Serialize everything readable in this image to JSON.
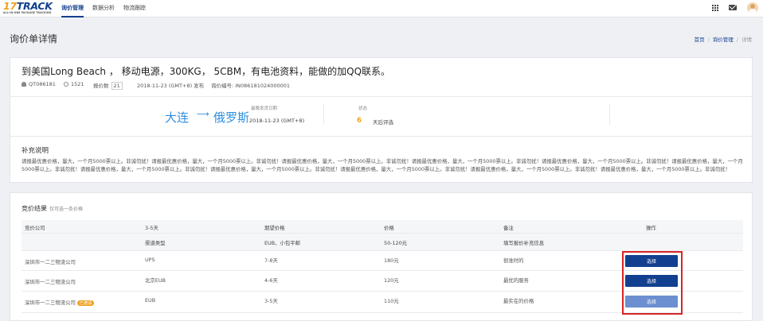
{
  "nav": {
    "logo_main_1": "17",
    "logo_main_2": "TRACK",
    "logo_sub": "ALL-IN-ONE PACKAGE TRACKING",
    "items": [
      "询价管理",
      "数据分析",
      "物流跟踪"
    ]
  },
  "page": {
    "title": "询价单详情",
    "breadcrumb": [
      "首页",
      "询价管理",
      "详情"
    ]
  },
  "inquiry": {
    "title": "到美国Long Beach ， 移动电源，300KG， 5CBM，有电池资料，能做的加QQ联系。",
    "user": "QT086181",
    "views": "1521",
    "quote_label": "报价数",
    "quote_count": "21",
    "published": "2018-11-23 (GMT+8) 发布",
    "inquiry_no": "询价编号: IN086181024000001",
    "from": "大连",
    "to": "俄罗斯",
    "arrow": "⟶",
    "ship_date_label": "最晚发货日期",
    "ship_date": "2018-11-23 (GMT+8)",
    "status_label": "状态",
    "status_days": "6",
    "status_text": "天后评选",
    "note_title": "补充说明",
    "note_text": "请报最优惠价格，量大，一个月5000票以上。非诚勿扰！请报最优惠价格，量大，一个月5000票以上。非诚勿扰！请报最优惠价格，量大，一个月5000票以上。非诚勿扰！请报最优惠价格，量大，一个月5000票以上。非诚勿扰！请报最优惠价格，量大，一个月5000票以上。非诚勿扰！请报最优惠价格，量大，一个月5000票以上。非诚勿扰！请报最优惠价格，量大，一个月5000票以上。非诚勿扰！请报最优惠价格，量大，一个月5000票以上。非诚勿扰！请报最优惠价格，量大，一个月5000票以上。非诚勿扰！请报最优惠价格，量大，一个月5000票以上。非诚勿扰！请报最优惠价格，量大，一个月5000票以上。非诚勿扰！"
  },
  "results": {
    "title": "竞价结果",
    "hint": "仅可选一条价格",
    "header": [
      "竞价公司",
      "3-5天",
      "期望价格",
      "价格",
      "备注",
      "操作"
    ],
    "subheader": [
      "",
      "渠道类型",
      "EUB、小包平邮",
      "50-120元",
      "填写报价补充信息",
      ""
    ],
    "rows": [
      {
        "company": "深圳市一二三物流公司",
        "badge": "",
        "channel": "UPS",
        "days": "7-8天",
        "price": "180元",
        "remark": "很准时的",
        "action": "选择"
      },
      {
        "company": "深圳市一二三物流公司",
        "badge": "",
        "channel": "北京EUB",
        "days": "4-6天",
        "price": "120元",
        "remark": "最优的服务",
        "action": "选择"
      },
      {
        "company": "深圳市一二三物流公司",
        "badge": "已邀请",
        "channel": "EUB",
        "days": "3-5天",
        "price": "110元",
        "remark": "最实在的价格",
        "action": "选择"
      }
    ]
  },
  "colors": {
    "brand": "#123f8f",
    "accent": "#f0a020",
    "route": "#2f8fe0",
    "highlight": "#d62525"
  },
  "icons": [
    "grid-icon",
    "mail-icon",
    "avatar",
    "user-icon",
    "eye-icon"
  ]
}
